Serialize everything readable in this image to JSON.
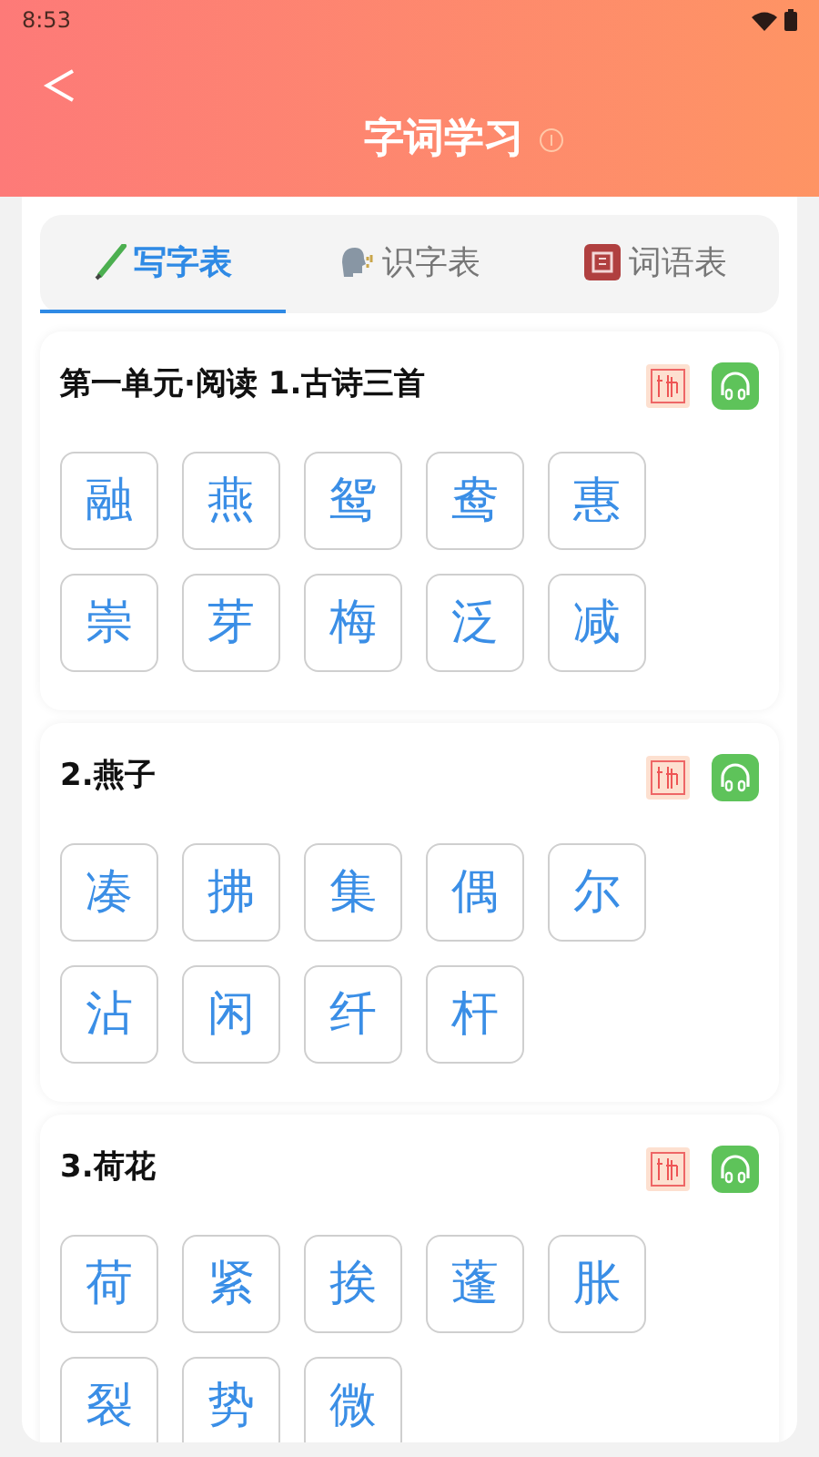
{
  "status_bar": {
    "time": "8:53"
  },
  "header": {
    "title": "字词学习"
  },
  "tabs": [
    {
      "label": "写字表",
      "kind": "pencil",
      "selected": true
    },
    {
      "label": "识字表",
      "kind": "speaker",
      "selected": false
    },
    {
      "label": "词语表",
      "kind": "book",
      "selected": false
    }
  ],
  "sections": [
    {
      "title": "第一单元·阅读 1.古诗三首",
      "chars": [
        "融",
        "燕",
        "鸳",
        "鸯",
        "惠",
        "崇",
        "芽",
        "梅",
        "泛",
        "减"
      ]
    },
    {
      "title": "2.燕子",
      "chars": [
        "凑",
        "拂",
        "集",
        "偶",
        "尔",
        "沾",
        "闲",
        "纤",
        "杆"
      ]
    },
    {
      "title": "3.荷花",
      "chars": [
        "荷",
        "紧",
        "挨",
        "蓬",
        "胀",
        "裂",
        "势",
        "微"
      ]
    }
  ]
}
